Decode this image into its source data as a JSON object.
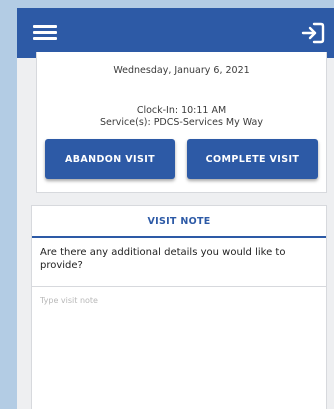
{
  "header": {
    "menu_icon": "hamburger-menu-icon",
    "logout_icon": "sign-out-icon",
    "background_color": "#2d5aa6"
  },
  "visit": {
    "date": "Wednesday, January 6, 2021",
    "clock_in": "Clock-In: 10:11 AM",
    "services": "Service(s): PDCS-Services My Way",
    "abandon_label": "ABANDON VISIT",
    "complete_label": "COMPLETE VISIT"
  },
  "visit_note": {
    "title": "VISIT NOTE",
    "question": "Are there any additional details you would like to provide?",
    "placeholder": "Type visit note",
    "value": ""
  },
  "colors": {
    "primary": "#2d5aa6",
    "page_background": "#b3cce4",
    "app_background": "#eeeff1"
  }
}
